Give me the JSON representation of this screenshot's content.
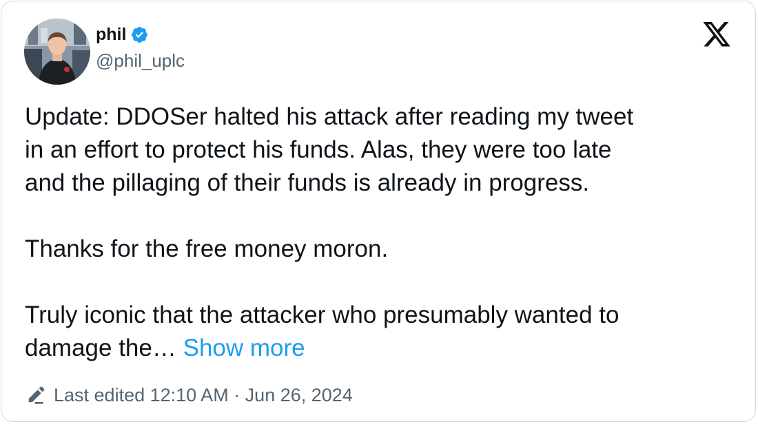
{
  "author": {
    "display_name": "phil",
    "handle": "@phil_uplc",
    "verified_icon": "verified-badge-icon",
    "avatar_icon": "profile-photo"
  },
  "platform": {
    "logo_icon": "x-logo-icon"
  },
  "tweet": {
    "paragraph_1": "Update: DDOSer halted his attack after reading my tweet\nin an effort to protect his funds. Alas, they were too late\nand the pillaging of their funds is already in progress.",
    "paragraph_2": "Thanks for the free money moron.",
    "paragraph_3": "Truly iconic that the attacker who presumably wanted to\ndamage the…",
    "show_more_label": "Show more"
  },
  "footer": {
    "edit_icon": "pencil-icon",
    "edited_text": "Last edited 12:10 AM · Jun 26, 2024"
  },
  "colors": {
    "link": "#1d9bf0",
    "verified": "#1d9bf0",
    "text": "#0f1419",
    "muted": "#536471",
    "border": "#cfd9de"
  }
}
